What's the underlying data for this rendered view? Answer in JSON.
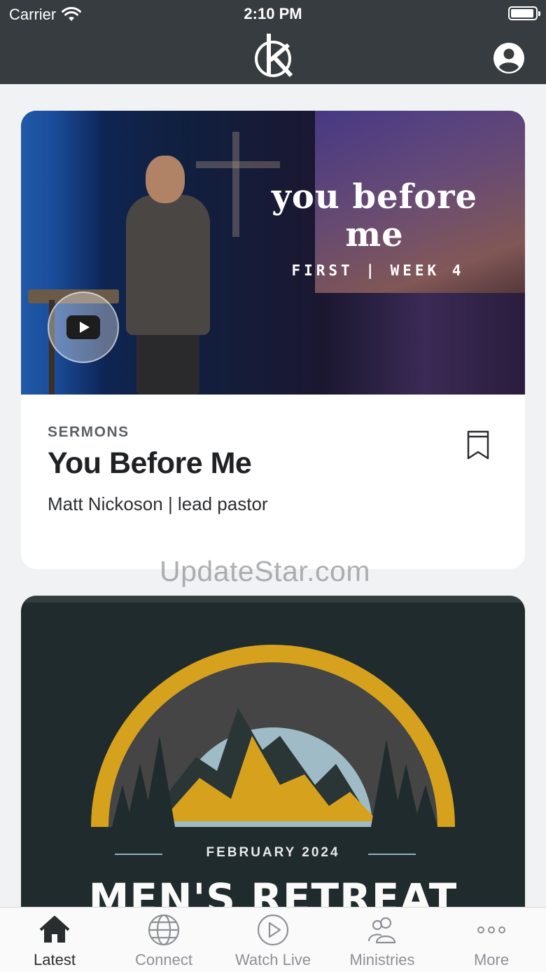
{
  "status_bar": {
    "carrier": "Carrier",
    "time": "2:10 PM"
  },
  "header": {
    "logo_icon": "ck-logo-icon",
    "profile_icon": "user-circle-icon"
  },
  "feed": {
    "cards": [
      {
        "artwork_title": "you before me",
        "artwork_subtitle": "FIRST | WEEK 4",
        "category": "SERMONS",
        "title": "You Before Me",
        "subtitle": "Matt Nickoson | lead pastor",
        "play_icon": "youtube-play-icon",
        "bookmark_icon": "bookmark-icon"
      },
      {
        "artwork_date": "FEBRUARY 2024",
        "artwork_title": "MEN'S RETREAT"
      }
    ]
  },
  "watermark": "UpdateStar.com",
  "tabbar": {
    "tabs": [
      {
        "label": "Latest",
        "icon": "home-icon",
        "active": true
      },
      {
        "label": "Connect",
        "icon": "globe-icon",
        "active": false
      },
      {
        "label": "Watch Live",
        "icon": "play-circle-icon",
        "active": false
      },
      {
        "label": "Ministries",
        "icon": "people-icon",
        "active": false
      },
      {
        "label": "More",
        "icon": "more-dots-icon",
        "active": false
      }
    ]
  },
  "colors": {
    "header_bg": "#363c3f",
    "page_bg": "#f1f2f4",
    "retreat_gold": "#d6a21e"
  }
}
